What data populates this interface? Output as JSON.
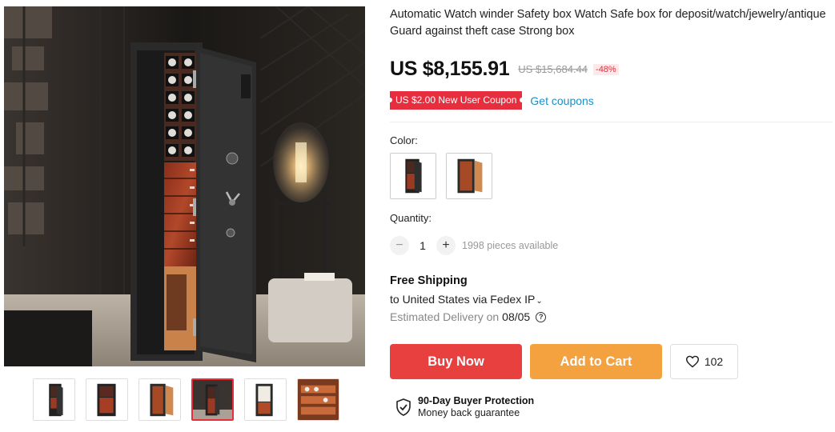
{
  "product": {
    "title": "Automatic Watch winder Safety box Watch Safe box for deposit/watch/jewelry/antique Guard against theft case Strong box",
    "price": "US $8,155.91",
    "original_price": "US $15,684.44",
    "discount": "-48%"
  },
  "coupon": {
    "badge": "US $2.00 New User Coupon",
    "link": "Get coupons"
  },
  "color": {
    "label": "Color:"
  },
  "quantity": {
    "label": "Quantity:",
    "value": "1",
    "minus": "−",
    "plus": "+",
    "available": "1998 pieces available"
  },
  "shipping": {
    "title": "Free Shipping",
    "destination": "to United States via Fedex IP",
    "caret": "⌄",
    "delivery_label": "Estimated Delivery on",
    "delivery_date": "08/05",
    "help": "?"
  },
  "actions": {
    "buy_now": "Buy Now",
    "add_to_cart": "Add to Cart",
    "wishlist_count": "102"
  },
  "protection": {
    "title": "90-Day Buyer Protection",
    "subtitle": "Money back guarantee"
  },
  "gallery": {
    "active_thumbnail": 4
  },
  "colors": {
    "accent": "#e62e3e",
    "buy": "#e8403f",
    "cart": "#f4a240",
    "link": "#1a8fc7"
  }
}
